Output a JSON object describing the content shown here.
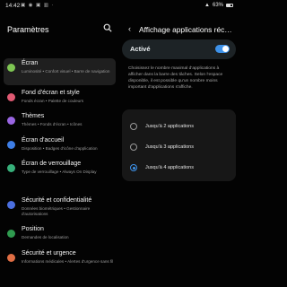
{
  "status_bar": {
    "time": "14:42",
    "icons": "▣ ◉ ▣ ▥ ·",
    "battery_text": "63%",
    "signal_glyph": "▲"
  },
  "left_pane": {
    "title": "Paramètres",
    "items": [
      {
        "title": "Écran",
        "subtitle": "Luminosité • Confort visuel • Barre de navigation",
        "color": "#7fc653",
        "icon": "sun-icon",
        "selected": true
      },
      {
        "title": "Fond d'écran et style",
        "subtitle": "Fonds écran • Palette de couleurs",
        "color": "#e05a73",
        "icon": "palette-icon"
      },
      {
        "title": "Thèmes",
        "subtitle": "Thèmes • Fonds d'écran • Icônes",
        "color": "#9a66e3",
        "icon": "brush-icon"
      },
      {
        "title": "Écran d'accueil",
        "subtitle": "Disposition • Badges d'icône d'application",
        "color": "#3e7ee6",
        "icon": "home-icon"
      },
      {
        "title": "Écran de verrouillage",
        "subtitle": "Type de verrouillage • Always On Display",
        "color": "#37b07a",
        "icon": "lock-icon"
      },
      {
        "title": "Sécurité et confidentialité",
        "subtitle": "Données biométriques • Gestionnaire d'autorisations",
        "color": "#4b6fdf",
        "icon": "shield-icon"
      },
      {
        "title": "Position",
        "subtitle": "Demandes de localisation",
        "color": "#2f9b4f",
        "icon": "location-pin-icon"
      },
      {
        "title": "Sécurité et urgence",
        "subtitle": "Informations médicales • Alertes d'urgence sans fil",
        "color": "#e06e44",
        "icon": "emergency-icon"
      }
    ]
  },
  "right_pane": {
    "back_glyph": "‹",
    "title": "Affichage applications réc…",
    "toggle": {
      "label": "Activé",
      "on": true
    },
    "description": "Choisissez le nombre maximal d'applications à afficher dans la barre des tâches. Selon l'espace disponible, il est possible qu'un nombre moins important d'applications s'affiche.",
    "options": [
      {
        "label": "Jusqu'à 2 applications",
        "checked": false
      },
      {
        "label": "Jusqu'à 3 applications",
        "checked": false
      },
      {
        "label": "Jusqu'à 4 applications",
        "checked": true
      }
    ]
  },
  "colors": {
    "accent": "#3e92e9",
    "background": "#030303",
    "card": "#171717"
  }
}
